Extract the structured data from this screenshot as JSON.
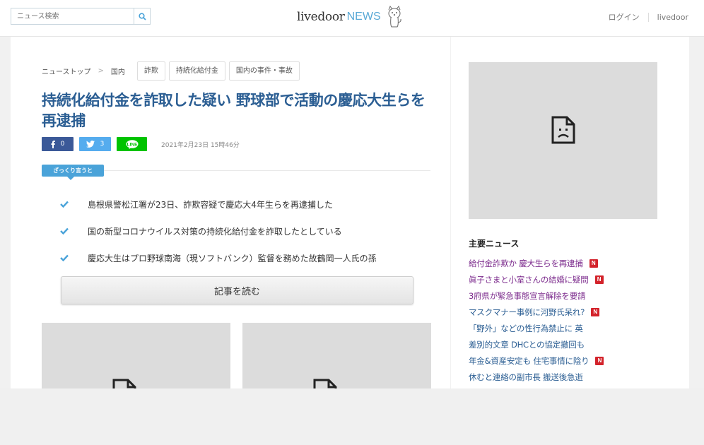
{
  "header": {
    "search_placeholder": "ニュース検索",
    "logo_main": "livedoor",
    "logo_news": "NEWS",
    "login_label": "ログイン",
    "livedoor_link": "livedoor"
  },
  "breadcrumb": {
    "items": [
      "ニューストップ",
      "国内"
    ],
    "separator": ">"
  },
  "tags": [
    "詐欺",
    "持続化給付金",
    "国内の事件・事故"
  ],
  "article": {
    "title": "持続化給付金を詐取した疑い 野球部で活動の慶応大生らを再逮捕",
    "date": "2021年2月23日 15時46分",
    "facebook_count": "0",
    "twitter_count": "3",
    "summary_label": "ざっくり言うと",
    "points": [
      "島根県警松江署が23日、詐欺容疑で慶応大4年生らを再逮捕した",
      "国の新型コロナウイルス対策の持続化給付金を詐取したとしている",
      "慶応大生はプロ野球南海（現ソフトバンク）監督を務めた故鶴岡一人氏の孫"
    ],
    "read_button": "記事を読む"
  },
  "sidebar": {
    "heading": "主要ニュース",
    "news": [
      {
        "text": "給付金詐欺か 慶大生らを再逮捕",
        "new": true,
        "visited": true
      },
      {
        "text": "眞子さまと小室さんの結婚に疑問",
        "new": true,
        "visited": true
      },
      {
        "text": "3府県が緊急事態宣言解除を要請",
        "new": false,
        "visited": true
      },
      {
        "text": "マスクマナー事例に河野氏呆れ?",
        "new": true,
        "visited": false
      },
      {
        "text": "「野外」などの性行為禁止に 英",
        "new": false,
        "visited": false
      },
      {
        "text": "差別的文章 DHCとの協定撤回も",
        "new": false,
        "visited": false
      },
      {
        "text": "年金&資産安定も 住宅事情に陰り",
        "new": true,
        "visited": false
      },
      {
        "text": "休むと連絡の副市長 搬送後急逝",
        "new": false,
        "visited": false
      }
    ],
    "new_badge": "N"
  },
  "colors": {
    "title_blue": "#2b5e93",
    "accent_blue": "#4aa3d9",
    "facebook": "#3b5998",
    "twitter": "#55acee",
    "line": "#00c300",
    "new_badge": "#d3232b"
  }
}
